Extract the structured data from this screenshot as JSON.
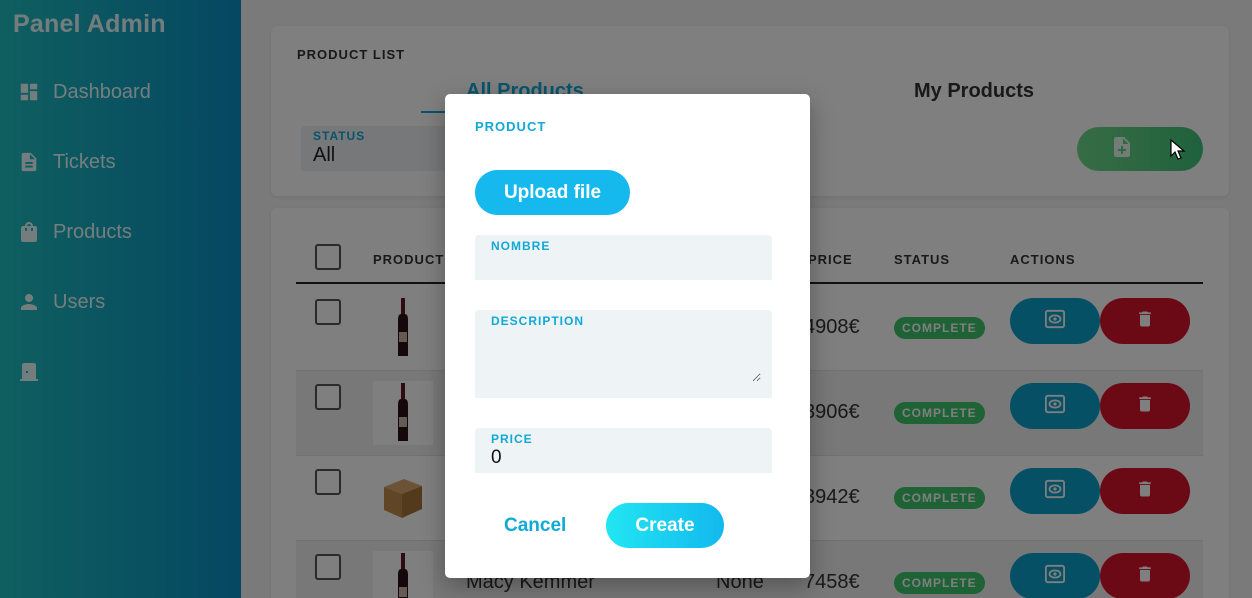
{
  "sidebar": {
    "brand": "Panel Admin",
    "items": [
      {
        "label": "Dashboard",
        "icon": "dashboard-icon"
      },
      {
        "label": "Tickets",
        "icon": "document-icon"
      },
      {
        "label": "Products",
        "icon": "shopping-bag-icon"
      },
      {
        "label": "Users",
        "icon": "user-icon"
      },
      {
        "label": "",
        "icon": "logout-door-icon"
      }
    ]
  },
  "product_list": {
    "title": "PRODUCT LIST",
    "tabs": [
      {
        "label": "All Products"
      },
      {
        "label": "My Products"
      }
    ],
    "status_filter": {
      "label": "STATUS",
      "value": "All"
    },
    "add_button_icons": [
      "file-add-icon"
    ]
  },
  "table": {
    "columns": [
      "PRODUCT",
      "PRICE",
      "STATUS",
      "ACTIONS"
    ],
    "rows": [
      {
        "name": "",
        "category": "",
        "price": "4908€",
        "status": "COMPLETE",
        "thumb": "wine-bottle"
      },
      {
        "name": "",
        "category": "",
        "price": "3906€",
        "status": "COMPLETE",
        "thumb": "wine-bottle"
      },
      {
        "name": "",
        "category": "",
        "price": "3942€",
        "status": "COMPLETE",
        "thumb": "cardboard-box"
      },
      {
        "name": "Macy Kemmer",
        "category": "None",
        "price": "7458€",
        "status": "COMPLETE",
        "thumb": "wine-bottle"
      }
    ]
  },
  "modal": {
    "title": "PRODUCT",
    "upload_label": "Upload file",
    "fields": {
      "nombre": {
        "label": "NOMBRE",
        "value": ""
      },
      "description": {
        "label": "DESCRIPTION",
        "value": ""
      },
      "price": {
        "label": "PRICE",
        "value": "0"
      }
    },
    "cancel_label": "Cancel",
    "create_label": "Create"
  },
  "colors": {
    "accent": "#11a9d6",
    "sidebar_start": "#1fbec0",
    "sidebar_end": "#0a8fc4",
    "status_complete": "#3cc46b",
    "delete": "#d6152b"
  }
}
